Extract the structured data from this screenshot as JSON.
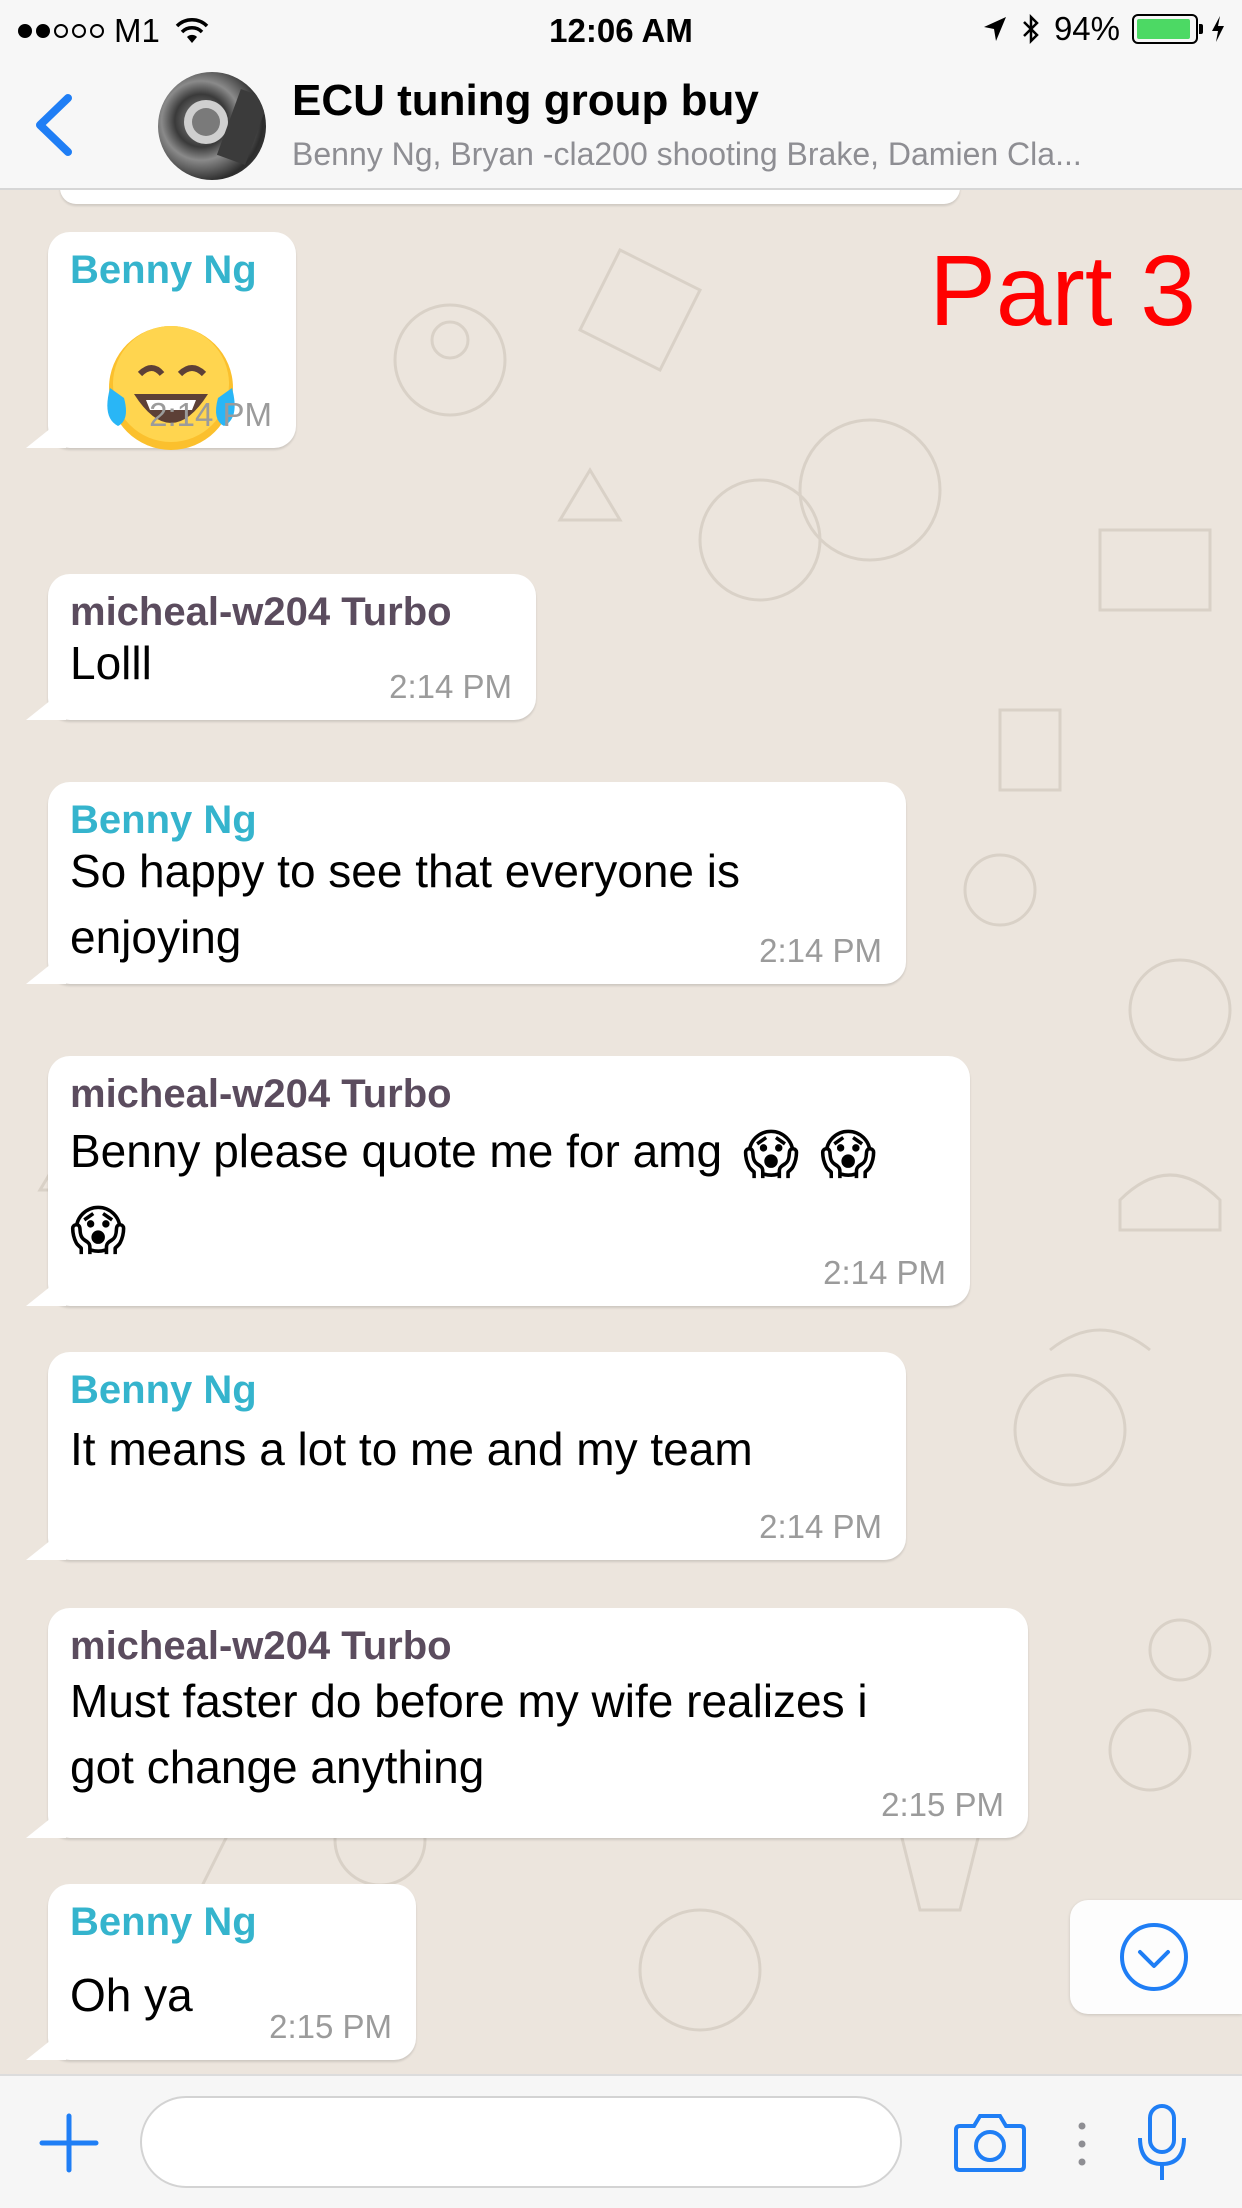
{
  "status_bar": {
    "carrier": "M1",
    "time": "12:06 AM",
    "battery": "94%",
    "battery_level": 0.94,
    "signal_bars": 2
  },
  "header": {
    "title": "ECU tuning group buy",
    "subtitle": "Benny Ng, Bryan -cla200 shooting Brake, Damien Cla..."
  },
  "overlay_label": "Part 3",
  "messages": [
    {
      "sender": "Benny Ng",
      "text": "😂",
      "time": "2:14 PM"
    },
    {
      "sender": "micheal-w204 Turbo",
      "text": "Lolll",
      "time": "2:14 PM"
    },
    {
      "sender": "Benny Ng",
      "text_lines": [
        "So happy to see that everyone is",
        "enjoying"
      ],
      "time": "2:14 PM"
    },
    {
      "sender": "micheal-w204 Turbo",
      "text": "Benny please quote me for amg",
      "emoji": "😱",
      "time": "2:14 PM"
    },
    {
      "sender": "Benny Ng",
      "text": "It means a lot to me and my team",
      "time": "2:14 PM"
    },
    {
      "sender": "micheal-w204 Turbo",
      "text_lines": [
        "Must faster do before my wife realizes i",
        "got change anything"
      ],
      "time": "2:15 PM"
    },
    {
      "sender": "Benny Ng",
      "text": "Oh ya",
      "time": "2:15 PM"
    }
  ],
  "icons": {
    "back": "chevron-left-icon",
    "plus": "plus-icon",
    "camera": "camera-icon",
    "more": "vertical-dots-icon",
    "mic": "microphone-icon",
    "scroll": "chevron-down-circle-icon"
  },
  "colors": {
    "accent": "#1f7ef5",
    "benny_name": "#35b4cd",
    "micheal_name": "#5b4c5e",
    "overlay_label": "#ff0000",
    "chat_background": "#ece5dd"
  }
}
